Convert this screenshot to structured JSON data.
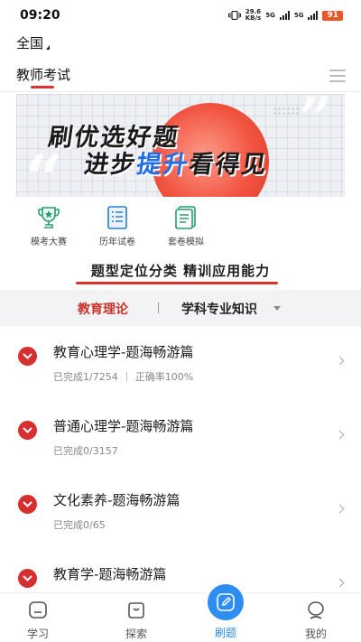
{
  "status_bar": {
    "time": "09:20",
    "net_speed_value": "29.6",
    "net_speed_unit": "KB/s",
    "sim1": "5G",
    "sim2": "5G",
    "battery": "91"
  },
  "region": {
    "label": "全国"
  },
  "category": {
    "label": "教师考试"
  },
  "banner": {
    "line1": "刷优选好题",
    "line2_prefix": "进步",
    "line2_highlight": "提升",
    "line2_suffix": "看得见"
  },
  "quick_entries": [
    {
      "label": "模考大赛",
      "icon": "trophy-icon"
    },
    {
      "label": "历年试卷",
      "icon": "paper-list-icon"
    },
    {
      "label": "套卷模拟",
      "icon": "document-icon"
    }
  ],
  "slogan": "题型定位分类 精训应用能力",
  "subject_tabs": {
    "active": "教育理论",
    "other": "学科专业知识"
  },
  "courses": [
    {
      "title": "教育心理学-题海畅游篇",
      "progress": "已完成1/7254",
      "accuracy": "正确率100%"
    },
    {
      "title": "普通心理学-题海畅游篇",
      "progress": "已完成0/3157",
      "accuracy": ""
    },
    {
      "title": "文化素养-题海畅游篇",
      "progress": "已完成0/65",
      "accuracy": ""
    },
    {
      "title": "教育学-题海畅游篇",
      "progress": "",
      "accuracy": ""
    }
  ],
  "bottom_nav": {
    "items": [
      {
        "label": "学习",
        "icon": "study-icon"
      },
      {
        "label": "探索",
        "icon": "explore-icon"
      },
      {
        "label": "刷题",
        "icon": "pen-icon"
      },
      {
        "label": "我的",
        "icon": "profile-icon"
      }
    ],
    "active_color": "#2d8df0"
  },
  "colors": {
    "accent_red": "#d8342c",
    "banner_highlight": "#1f6ee8"
  }
}
